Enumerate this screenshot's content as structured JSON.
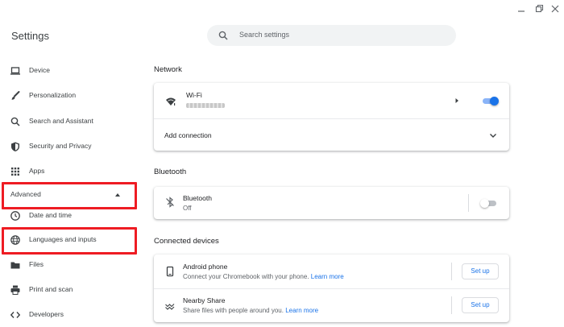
{
  "window": {
    "title": "Settings",
    "controls": [
      "minimize-icon",
      "restore-icon",
      "close-icon"
    ]
  },
  "search": {
    "placeholder": "Search settings",
    "icon": "search-icon"
  },
  "sidebar": {
    "items": [
      {
        "label": "Device",
        "icon": "laptop-icon"
      },
      {
        "label": "Personalization",
        "icon": "brush-icon"
      },
      {
        "label": "Search and Assistant",
        "icon": "search-icon"
      },
      {
        "label": "Security and Privacy",
        "icon": "shield-icon"
      },
      {
        "label": "Apps",
        "icon": "apps-grid-icon"
      }
    ],
    "advanced": {
      "label": "Advanced",
      "icon": "caret-up-icon"
    },
    "advanced_items": [
      {
        "label": "Date and time",
        "icon": "clock-icon"
      },
      {
        "label": "Languages and inputs",
        "icon": "globe-icon"
      },
      {
        "label": "Files",
        "icon": "folder-icon"
      },
      {
        "label": "Print and scan",
        "icon": "printer-icon"
      },
      {
        "label": "Developers",
        "icon": "code-icon"
      }
    ]
  },
  "network": {
    "title": "Network",
    "wifi": {
      "label": "Wi-Fi",
      "enabled": true,
      "icon": "wifi-icon"
    },
    "add_connection": {
      "label": "Add connection",
      "icon": "chevron-down-icon"
    }
  },
  "bluetooth": {
    "title": "Bluetooth",
    "row": {
      "label": "Bluetooth",
      "status": "Off",
      "enabled": false,
      "icon": "bluetooth-disabled-icon"
    }
  },
  "connected_devices": {
    "title": "Connected devices",
    "android": {
      "label": "Android phone",
      "desc": "Connect your Chromebook with your phone.",
      "link": "Learn more",
      "button": "Set up",
      "icon": "phone-icon"
    },
    "nearby": {
      "label": "Nearby Share",
      "desc": "Share files with people around you.",
      "link": "Learn more",
      "button": "Set up",
      "icon": "nearby-share-icon"
    }
  },
  "colors": {
    "accent": "#1a73e8",
    "highlight": "#ee1c23",
    "toggle_on_track": "#8ab4f8",
    "toggle_off_track": "#bdc1c6"
  }
}
